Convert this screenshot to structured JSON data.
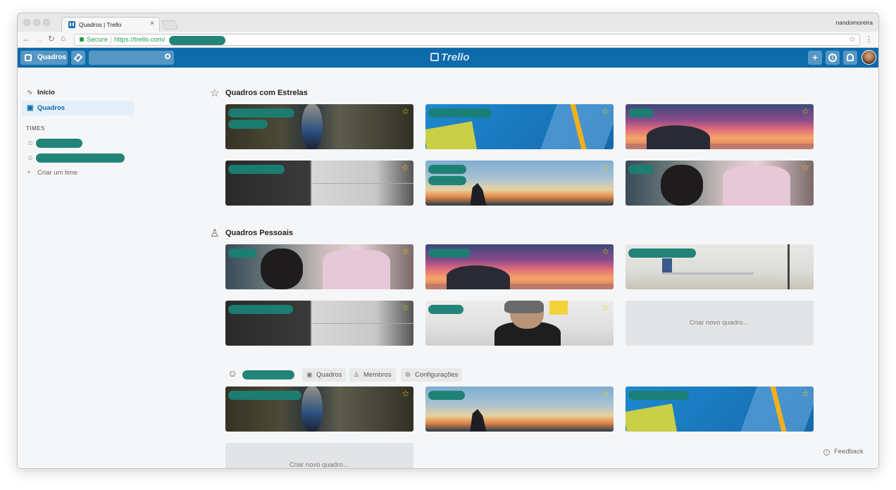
{
  "browser": {
    "tab_title": "Quadros | Trello",
    "tab_close": "×",
    "profile_name": "nandomoreira",
    "secure_label": "Secure",
    "url": "https://trello.com/",
    "nav_back": "←",
    "nav_forward": "→",
    "nav_reload": "↻",
    "nav_home": "⌂",
    "bookmark_icon": "☆",
    "menu_icon": "⋮"
  },
  "header": {
    "boards_button": "Quadros",
    "logo_text": "Trello",
    "add_icon": "+",
    "info_icon": "i",
    "notifications_icon": "bell-icon",
    "brand_color": "#0e6aab"
  },
  "sidebar": {
    "items": [
      {
        "label": "Início",
        "icon": "activity-icon"
      },
      {
        "label": "Quadros",
        "icon": "board-icon",
        "active": true
      }
    ],
    "teams_heading": "TIMES",
    "teams": [
      {
        "label": ""
      },
      {
        "label": ""
      }
    ],
    "create_team": "Criar um time",
    "create_team_icon": "+"
  },
  "sections": {
    "starred": {
      "title": "Quadros com Estrelas",
      "icon": "star-outline-icon",
      "boards": [
        {
          "image": "hourglass",
          "starred": true
        },
        {
          "image": "blue-desk",
          "starred": true
        },
        {
          "image": "sunset-rock",
          "starred": true
        },
        {
          "image": "dark-wall",
          "starred": true
        },
        {
          "image": "dusk-cliff",
          "starred": true
        },
        {
          "image": "classroom",
          "starred": true
        }
      ]
    },
    "personal": {
      "title": "Quadros Pessoais",
      "icon": "person-icon",
      "boards": [
        {
          "image": "classroom",
          "starred": true
        },
        {
          "image": "sunset-rock",
          "starred": true
        },
        {
          "image": "desk-shelf",
          "starred": false
        },
        {
          "image": "dark-wall",
          "starred": true
        },
        {
          "image": "man-whiteboard",
          "starred": true
        }
      ],
      "create_label": "Criar novo quadro…"
    },
    "team": {
      "icon": "team-icon",
      "tabs": [
        {
          "label": "Quadros",
          "icon": "board-icon"
        },
        {
          "label": "Membros",
          "icon": "person-icon"
        },
        {
          "label": "Configurações",
          "icon": "gear-icon"
        }
      ],
      "boards": [
        {
          "image": "hourglass",
          "starred": true
        },
        {
          "image": "dusk-cliff",
          "starred": true
        },
        {
          "image": "blue-desk",
          "starred": true
        }
      ],
      "create_label": "Criar novo quadro…"
    }
  },
  "feedback": {
    "label": "Feedback",
    "icon": "info-circle-icon"
  }
}
